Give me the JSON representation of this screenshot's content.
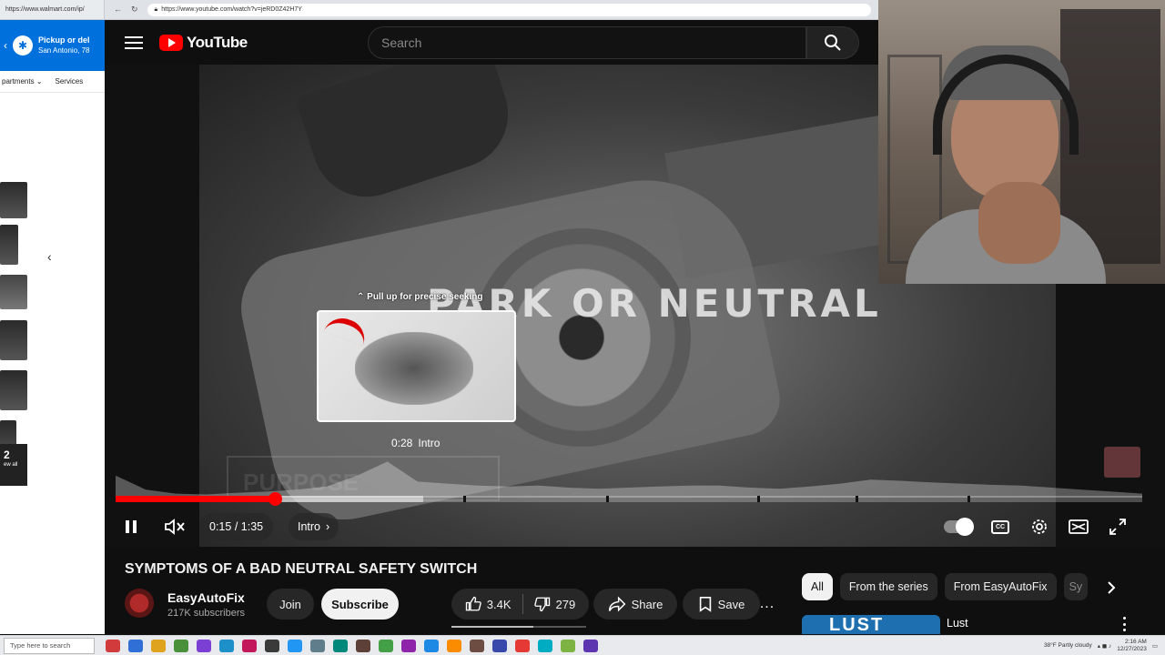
{
  "browser": {
    "left_tab_url": "https://www.walmart.com/ip/",
    "url": "https://www.youtube.com/watch?v=jeRD0Z42H7Y"
  },
  "walmart": {
    "pickup_title": "Pickup or del",
    "pickup_location": "San Antonio, 78",
    "nav_departments": "partments",
    "nav_services": "Services",
    "badge_number": "2",
    "badge_text": "ew all"
  },
  "youtube": {
    "logo_text": "YouTube",
    "search_placeholder": "Search"
  },
  "player": {
    "overlay_text": "PARK OR NEUTRAL",
    "ghost_text": "PURPOSE",
    "seek_hint": "Pull up for precise seeking",
    "preview_time": "0:28",
    "preview_chapter": "Intro",
    "current_time": "0:15",
    "duration": "1:35",
    "time_separator": " / ",
    "chapter_label": "Intro",
    "played_fraction": 0.155,
    "buffered_fraction": 0.3,
    "chapter_breaks": [
      0.339,
      0.478,
      0.625,
      0.721,
      0.83
    ],
    "heatmap": [
      0.55,
      0.2,
      0.1,
      0.08,
      0.12,
      0.15,
      0.2,
      0.28,
      0.55,
      0.9,
      0.4,
      0.35,
      0.3,
      0.28,
      0.3,
      0.25,
      0.22,
      0.25,
      0.28,
      0.3,
      0.3,
      0.25,
      0.22,
      0.28,
      0.35,
      0.45,
      0.42,
      0.38,
      0.35,
      0.32,
      0.3,
      0.25,
      0.2,
      0.15,
      0.1
    ]
  },
  "video": {
    "title": "SYMPTOMS OF A BAD NEUTRAL SAFETY SWITCH",
    "channel_name": "EasyAutoFix",
    "subscribers": "217K subscribers",
    "join_label": "Join",
    "subscribe_label": "Subscribe",
    "likes": "3.4K",
    "dislikes": "279",
    "share_label": "Share",
    "save_label": "Save",
    "more_label": "..."
  },
  "chips": {
    "items": [
      "All",
      "From the series",
      "From EasyAutoFix",
      "Sy"
    ]
  },
  "recommendation": {
    "thumb_text": "LUST",
    "title": "Lust"
  },
  "taskbar": {
    "search_placeholder": "Type here to search",
    "weather": "38°F  Partly cloudy",
    "time": "2:16 AM",
    "date": "12/27/2023",
    "icon_colors": [
      "#d13b3b",
      "#2f6fd6",
      "#e0a31d",
      "#4a8f3a",
      "#7b3fd4",
      "#1d8fc9",
      "#c2185b",
      "#3a3a3a",
      "#2196f3",
      "#607d8b",
      "#00897b",
      "#5d4037",
      "#43a047",
      "#8e24aa",
      "#1e88e5",
      "#fb8c00",
      "#6d4c41",
      "#3949ab",
      "#e53935",
      "#00acc1",
      "#7cb342",
      "#5e35b1"
    ]
  }
}
